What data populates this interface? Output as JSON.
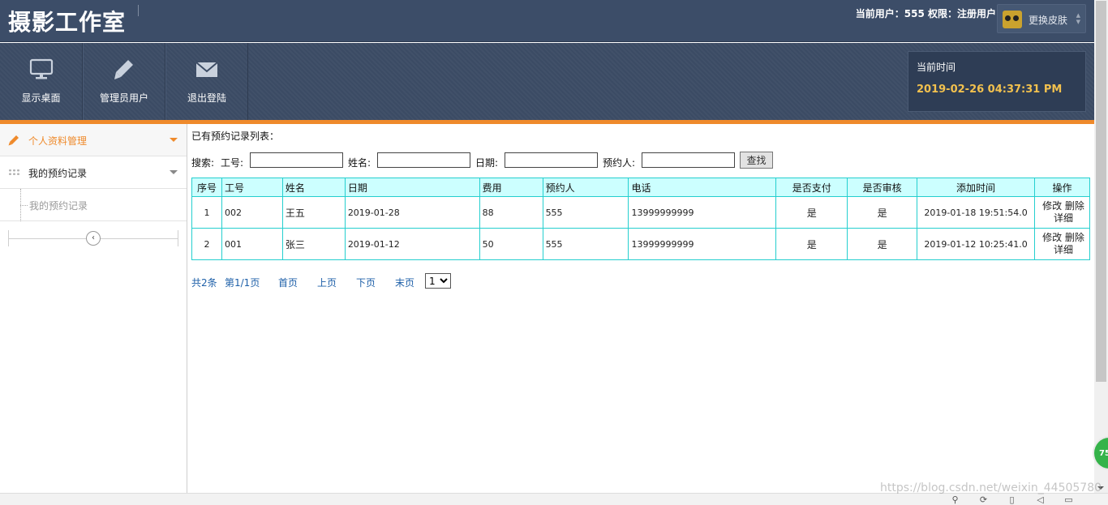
{
  "header": {
    "title": "摄影工作室",
    "user_info": "当前用户：555  权限：注册用户",
    "skin_label": "更换皮肤"
  },
  "nav": {
    "items": [
      {
        "label": "显示桌面",
        "icon": "monitor-icon"
      },
      {
        "label": "管理员用户",
        "icon": "pencil-icon"
      },
      {
        "label": "退出登陆",
        "icon": "envelope-icon"
      }
    ],
    "time_panel": {
      "label": "当前时间",
      "value": "2019-02-26 04:37:31 PM"
    }
  },
  "sidebar": {
    "items": [
      {
        "label": "个人资料管理",
        "icon": "pencil-icon",
        "active": true
      },
      {
        "label": "我的预约记录",
        "icon": "grid-icon",
        "active": false
      }
    ],
    "sub_item": "我的预约记录",
    "collapse_glyph": "‹"
  },
  "main": {
    "list_title": "已有预约记录列表：",
    "search": {
      "prefix": "搜索:",
      "fields": [
        {
          "label": "工号:",
          "value": ""
        },
        {
          "label": "姓名:",
          "value": ""
        },
        {
          "label": "日期:",
          "value": ""
        },
        {
          "label": "预约人:",
          "value": ""
        }
      ],
      "button": "查找"
    },
    "table": {
      "headers": [
        "序号",
        "工号",
        "姓名",
        "日期",
        "费用",
        "预约人",
        "电话",
        "是否支付",
        "是否审核",
        "添加时间",
        "操作"
      ],
      "rows": [
        {
          "seq": "1",
          "emp_no": "002",
          "name": "王五",
          "date": "2019-01-28",
          "fee": "88",
          "booker": "555",
          "phone": "13999999999",
          "paid": "是",
          "reviewed": "是",
          "added": "2019-01-18 19:51:54.0"
        },
        {
          "seq": "2",
          "emp_no": "001",
          "name": "张三",
          "date": "2019-01-12",
          "fee": "50",
          "booker": "555",
          "phone": "13999999999",
          "paid": "是",
          "reviewed": "是",
          "added": "2019-01-12 10:25:41.0"
        }
      ],
      "ops": {
        "edit": "修改",
        "delete": "删除",
        "detail": "详细"
      }
    },
    "pager": {
      "total": "共2条",
      "page": "第1/1页",
      "first": "首页",
      "prev": "上页",
      "next": "下页",
      "last": "末页",
      "selected": "1"
    }
  },
  "watermark": "https://blog.csdn.net/weixin_44505780",
  "float_badge": "75",
  "colors": {
    "header_bg": "#3c4d68",
    "accent_orange": "#ef8a2b",
    "time_yellow": "#f2c14e",
    "table_header_bg": "#ccffff",
    "table_border": "#25cfcf",
    "link_blue": "#1d5fa8"
  }
}
